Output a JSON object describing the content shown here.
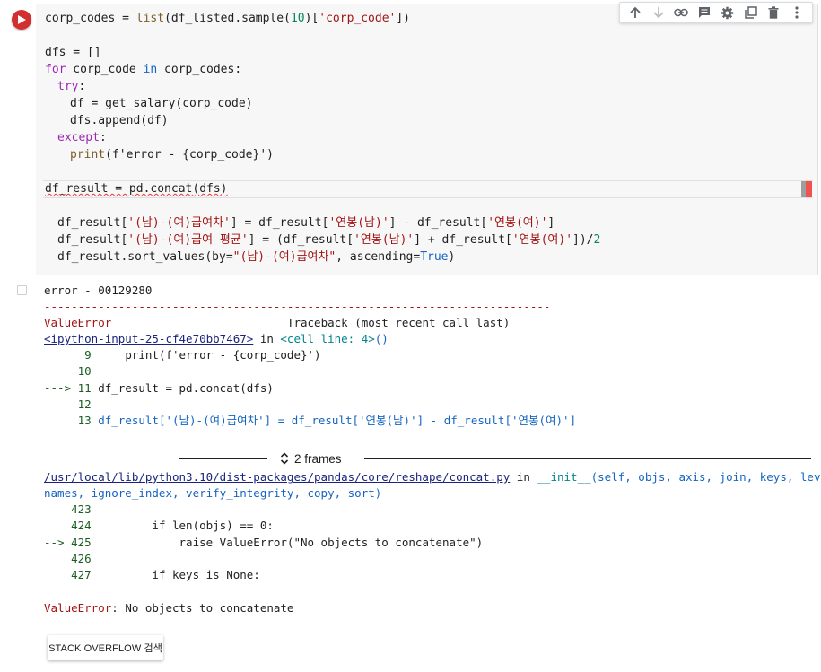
{
  "code": {
    "line1": {
      "a": "corp_codes = ",
      "b": "list",
      "c": "(df_listed.sample(",
      "d": "10",
      "e": ")[",
      "f": "'corp_code'",
      "g": "])"
    },
    "line3": {
      "a": "dfs = []"
    },
    "line4": {
      "a": "for",
      "b": " corp_code ",
      "c": "in",
      "d": " corp_codes:"
    },
    "line5": {
      "a": "try",
      "b": ":"
    },
    "line6": {
      "a": "df = get_salary(corp_code)"
    },
    "line7": {
      "a": "dfs.append(df)"
    },
    "line8": {
      "a": "except",
      "b": ":"
    },
    "line9": {
      "a": "print",
      "b": "(f'error - {corp_code}')"
    },
    "line11": {
      "a": "df_result = pd.concat",
      "b": "(dfs)"
    },
    "line13": {
      "a": "df_result[",
      "b": "'(남)-(여)급여차'",
      "c": "] = df_result[",
      "d": "'연봉(남)'",
      "e": "] - df_result[",
      "f": "'연봉(여)'",
      "g": "]"
    },
    "line14": {
      "a": "df_result[",
      "b": "'(남)-(여)급여 평균'",
      "c": "] = (df_result[",
      "d": "'연봉(남)'",
      "e": "] + df_result[",
      "f": "'연봉(여)'",
      "g": "])/",
      "h": "2"
    },
    "line15": {
      "a": "df_result.sort_values(by=",
      "b": "\"(남)-(여)급여차\"",
      "c": ", ascending=",
      "d": "True",
      "e": ")"
    }
  },
  "toolbar": {
    "icons": [
      "arrow-up-icon",
      "arrow-down-icon",
      "link-icon",
      "comment-icon",
      "settings-icon",
      "mirror-cell-icon",
      "delete-icon",
      "more-icon"
    ]
  },
  "output": {
    "l1": "error - 00129280",
    "l2": "---------------------------------------------------------------------------",
    "l3a": "ValueError",
    "l3b": "Traceback (most recent call last)",
    "l4a": "<ipython-input-25-cf4e70bb7467>",
    "l4b": " in ",
    "l4c": "<cell line: 4>",
    "l4d": "()",
    "l5n": "      9",
    "l5c": "     print(f'error - {corp_code}')",
    "l6n": "     10",
    "l7n": "---> 11",
    "l7c": " df_result = pd.concat(dfs)",
    "l8n": "     12",
    "l9n": "     13",
    "l9c": " df_result['(남)-(여)급여차'] = df_result['연봉(남)'] - df_result['연봉(여)']",
    "frames_label": "2 frames",
    "l10a": "/usr/local/lib/python3.10/dist-packages/pandas/core/reshape/concat.py",
    "l10b": " in ",
    "l10c": "__init__",
    "l10d": "(self, objs, axis, join, keys, levels,",
    "l11": "names, ignore_index, verify_integrity, copy, sort)",
    "l12n": "    423",
    "l13n": "    424",
    "l13c": "         if len(objs) == 0:",
    "l14n": "--> 425",
    "l14c": "             raise ValueError(\"No objects to concatenate\")",
    "l15n": "    426",
    "l16n": "    427",
    "l16c": "         if keys is None:",
    "l17a": "ValueError",
    "l17b": ": No objects to concatenate"
  },
  "stack_overflow_button": "STACK OVERFLOW 검색"
}
